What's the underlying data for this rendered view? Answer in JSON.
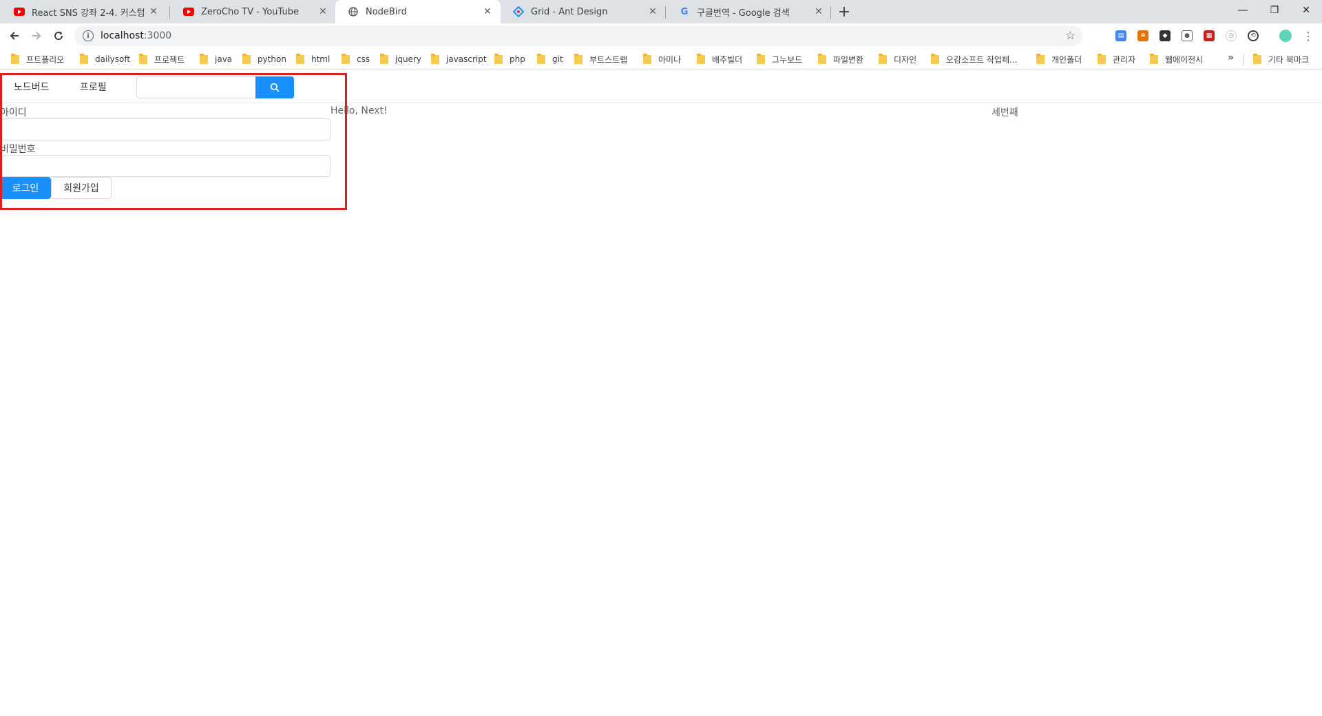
{
  "browser": {
    "tabs": [
      {
        "title": "React SNS 강좌 2-4. 커스텀 훅",
        "favicon": "youtube-icon",
        "active": false
      },
      {
        "title": "ZeroCho TV - YouTube",
        "favicon": "youtube-icon",
        "active": false
      },
      {
        "title": "NodeBird",
        "favicon": "globe-icon",
        "active": true
      },
      {
        "title": "Grid - Ant Design",
        "favicon": "ant-design-icon",
        "active": false
      },
      {
        "title": "구글번역 - Google 검색",
        "favicon": "google-icon",
        "active": false
      }
    ],
    "new_tab": "+",
    "url_host": "localhost",
    "url_port": ":3000",
    "bookmarks": [
      "프트폴리오",
      "dailysoft",
      "프로젝트",
      "java",
      "python",
      "html",
      "css",
      "jquery",
      "javascript",
      "php",
      "git",
      "부트스트랩",
      "아미나",
      "배추빌더",
      "그누보드",
      "파일변환",
      "디자인",
      "오감소프트 작업페...",
      "개인폴더",
      "관리자",
      "웹에이전시"
    ],
    "bookmarks_more": "»",
    "other_bookmarks": "기타 북마크"
  },
  "app": {
    "menu": {
      "home": "노드버드",
      "profile": "프로필"
    },
    "search": {
      "value": "",
      "icon": "search-icon"
    },
    "login": {
      "id_label": "아이디",
      "id_value": "",
      "password_label": "비밀번호",
      "password_value": "",
      "login_button": "로그인",
      "signup_button": "회원가입"
    },
    "middle_text": "Hello, Next!",
    "right_text": "세번째"
  },
  "colors": {
    "primary": "#1890ff",
    "highlight_box": "#e02020",
    "tabstrip": "#dee1e6"
  }
}
